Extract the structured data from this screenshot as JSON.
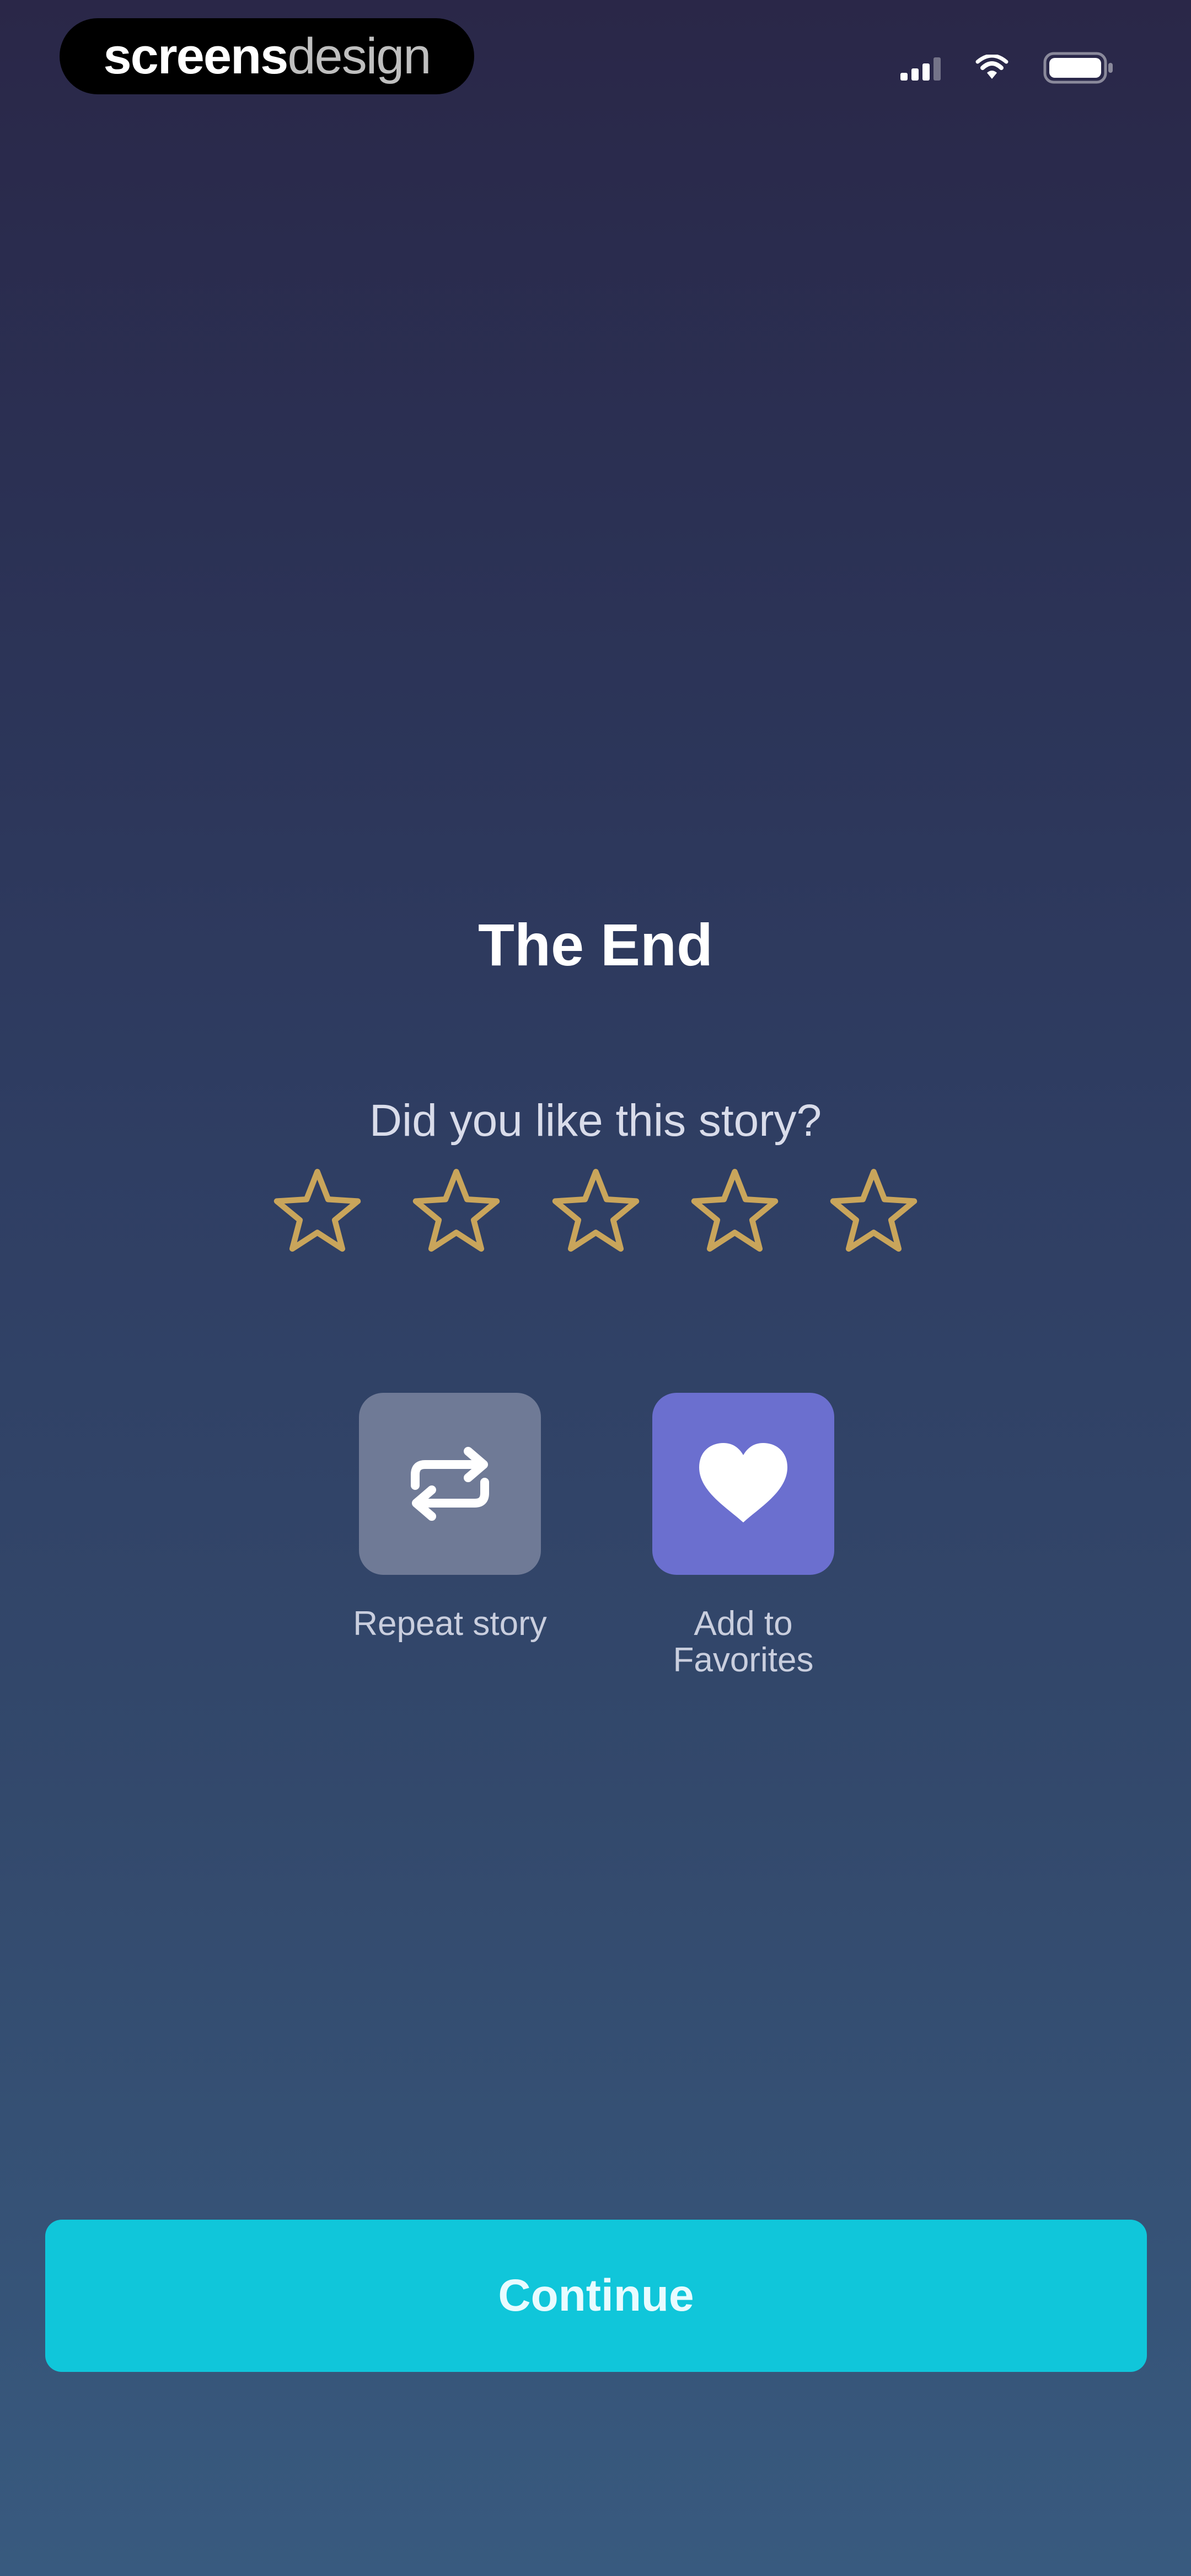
{
  "status_bar": {
    "brand_strong": "screens",
    "brand_light": "design",
    "signal_icon": "cellular-signal-icon",
    "wifi_icon": "wifi-icon",
    "battery_icon": "battery-icon"
  },
  "main": {
    "title": "The End",
    "rating_prompt": "Did you like this story?",
    "rating": {
      "selected": 0,
      "max": 5,
      "star_icon": "star-outline-icon",
      "star_color": "#c9a55b"
    },
    "actions": [
      {
        "label": "Repeat story",
        "icon": "repeat-icon",
        "color": "#6f7a96"
      },
      {
        "label": "Add to Favorites",
        "icon": "heart-icon",
        "color": "#6b6fcf"
      }
    ]
  },
  "footer": {
    "continue_label": "Continue",
    "continue_color": "#10c6da"
  }
}
